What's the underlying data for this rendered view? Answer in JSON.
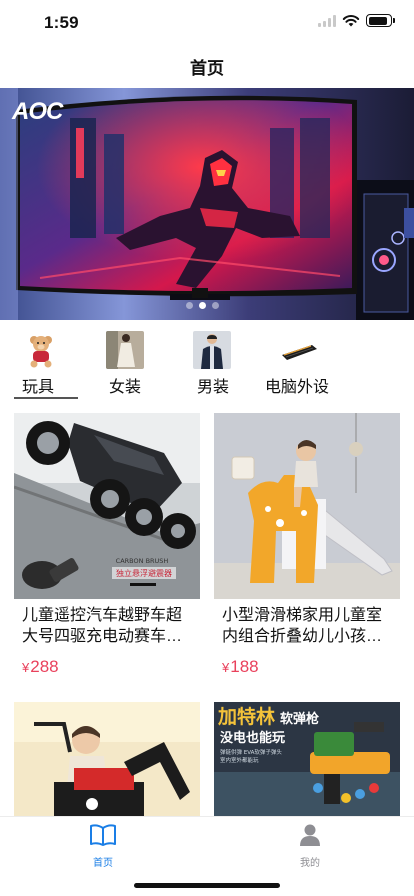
{
  "status_bar": {
    "time": "1:59",
    "battery_level": 0.9
  },
  "nav": {
    "title": "首页"
  },
  "banner": {
    "logo": "AOC",
    "slide_count": 3,
    "active_slide": 2
  },
  "categories": [
    {
      "label": "玩具",
      "selected": true,
      "icon": "teddy-bear-thumb"
    },
    {
      "label": "女装",
      "selected": false,
      "icon": "dress-model-thumb"
    },
    {
      "label": "男装",
      "selected": false,
      "icon": "jacket-model-thumb"
    },
    {
      "label": "电脑外设",
      "selected": false,
      "icon": "keyboard-thumb"
    }
  ],
  "products": [
    {
      "title": "儿童遥控汽车越野车超大号四驱充电动赛车攀爬车男孩玩具车",
      "currency": "¥",
      "price": "288",
      "image_text": [
        "CARBON BRUSH",
        "独立悬浮避震器"
      ]
    },
    {
      "title": "小型滑滑梯家用儿童室内组合折叠幼儿小孩玩具滑梯",
      "currency": "¥",
      "price": "188"
    },
    {
      "title": "",
      "currency": "",
      "price": ""
    },
    {
      "title": "",
      "currency": "",
      "price": "",
      "image_text": [
        "加特林",
        "软弹枪",
        "没电也能玩",
        "弹链供弹 EVA软弹子弹头",
        "室内室外都能玩"
      ]
    }
  ],
  "tab_bar": {
    "tabs": [
      {
        "label": "首页",
        "icon": "book-icon",
        "active": true
      },
      {
        "label": "我的",
        "icon": "person-icon",
        "active": false
      }
    ]
  },
  "colors": {
    "accent": "#1a7ee6",
    "price": "#e9415c",
    "inactive": "#8e8e93"
  }
}
